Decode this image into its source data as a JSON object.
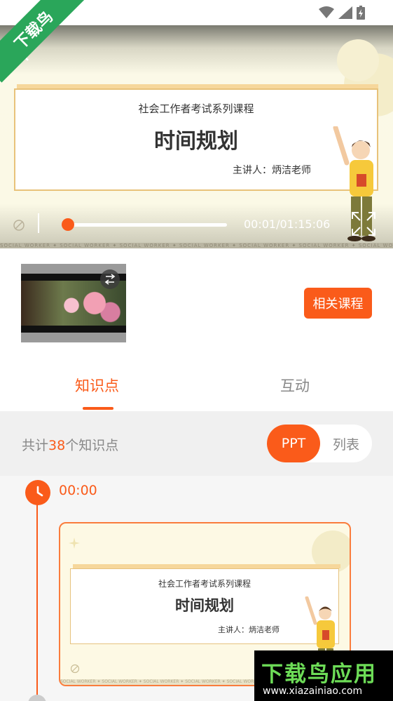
{
  "corner_banner": "下载鸟",
  "video": {
    "slide": {
      "series": "社会工作者考试系列课程",
      "title": "时间规划",
      "presenter": "主讲人：炳洁老师"
    },
    "time": "00:01/01:15:06",
    "progress": 0.01,
    "strip_text": "SOCIAL WORKER ✦ SOCIAL WORKER ✦ SOCIAL WORKER ✦ SOCIAL WORKER ✦ SOCIAL WORKER ✦ SOCIAL WORKER ✦ SOCIAL WORKER"
  },
  "info": {
    "related_button": "相关课程"
  },
  "tabs": {
    "knowledge": "知识点",
    "interact": "互动"
  },
  "summary": {
    "prefix": "共计",
    "count": "38",
    "suffix": "个知识点",
    "toggle_ppt": "PPT",
    "toggle_list": "列表"
  },
  "timeline": {
    "first_time": "00:00",
    "card": {
      "series": "社会工作者考试系列课程",
      "title": "时间规划",
      "presenter": "主讲人：炳洁老师",
      "strip_text": "SOCIAL WORKER ✦ SOCIAL WORKER ✦ SOCIAL WORKER ✦ SOCIAL WORKER ✦ SOCIAL WORKER"
    }
  },
  "watermark": {
    "title": "下载鸟应用",
    "url": "www.xiazainiao.com"
  },
  "colors": {
    "accent": "#fa5b1a",
    "banner": "#2aa65a"
  }
}
